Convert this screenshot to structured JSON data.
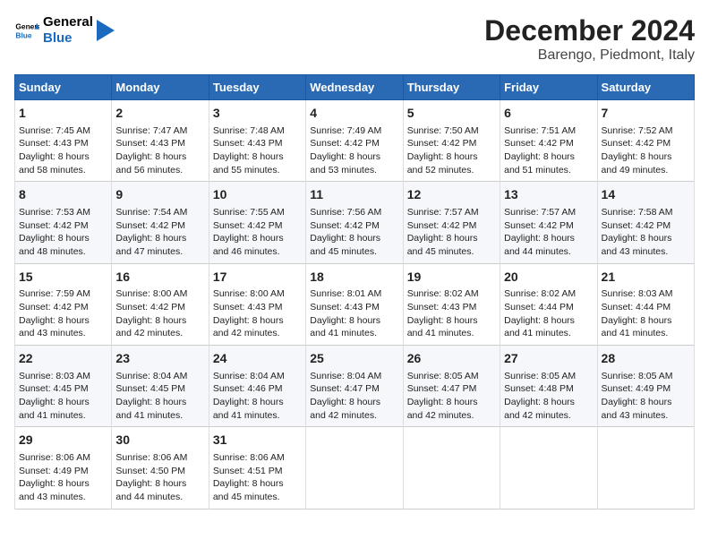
{
  "header": {
    "logo_general": "General",
    "logo_blue": "Blue",
    "title": "December 2024",
    "subtitle": "Barengo, Piedmont, Italy"
  },
  "days_of_week": [
    "Sunday",
    "Monday",
    "Tuesday",
    "Wednesday",
    "Thursday",
    "Friday",
    "Saturday"
  ],
  "weeks": [
    [
      {
        "day": "1",
        "sunrise": "7:45 AM",
        "sunset": "4:43 PM",
        "daylight": "8 hours and 58 minutes."
      },
      {
        "day": "2",
        "sunrise": "7:47 AM",
        "sunset": "4:43 PM",
        "daylight": "8 hours and 56 minutes."
      },
      {
        "day": "3",
        "sunrise": "7:48 AM",
        "sunset": "4:43 PM",
        "daylight": "8 hours and 55 minutes."
      },
      {
        "day": "4",
        "sunrise": "7:49 AM",
        "sunset": "4:42 PM",
        "daylight": "8 hours and 53 minutes."
      },
      {
        "day": "5",
        "sunrise": "7:50 AM",
        "sunset": "4:42 PM",
        "daylight": "8 hours and 52 minutes."
      },
      {
        "day": "6",
        "sunrise": "7:51 AM",
        "sunset": "4:42 PM",
        "daylight": "8 hours and 51 minutes."
      },
      {
        "day": "7",
        "sunrise": "7:52 AM",
        "sunset": "4:42 PM",
        "daylight": "8 hours and 49 minutes."
      }
    ],
    [
      {
        "day": "8",
        "sunrise": "7:53 AM",
        "sunset": "4:42 PM",
        "daylight": "8 hours and 48 minutes."
      },
      {
        "day": "9",
        "sunrise": "7:54 AM",
        "sunset": "4:42 PM",
        "daylight": "8 hours and 47 minutes."
      },
      {
        "day": "10",
        "sunrise": "7:55 AM",
        "sunset": "4:42 PM",
        "daylight": "8 hours and 46 minutes."
      },
      {
        "day": "11",
        "sunrise": "7:56 AM",
        "sunset": "4:42 PM",
        "daylight": "8 hours and 45 minutes."
      },
      {
        "day": "12",
        "sunrise": "7:57 AM",
        "sunset": "4:42 PM",
        "daylight": "8 hours and 45 minutes."
      },
      {
        "day": "13",
        "sunrise": "7:57 AM",
        "sunset": "4:42 PM",
        "daylight": "8 hours and 44 minutes."
      },
      {
        "day": "14",
        "sunrise": "7:58 AM",
        "sunset": "4:42 PM",
        "daylight": "8 hours and 43 minutes."
      }
    ],
    [
      {
        "day": "15",
        "sunrise": "7:59 AM",
        "sunset": "4:42 PM",
        "daylight": "8 hours and 43 minutes."
      },
      {
        "day": "16",
        "sunrise": "8:00 AM",
        "sunset": "4:42 PM",
        "daylight": "8 hours and 42 minutes."
      },
      {
        "day": "17",
        "sunrise": "8:00 AM",
        "sunset": "4:43 PM",
        "daylight": "8 hours and 42 minutes."
      },
      {
        "day": "18",
        "sunrise": "8:01 AM",
        "sunset": "4:43 PM",
        "daylight": "8 hours and 41 minutes."
      },
      {
        "day": "19",
        "sunrise": "8:02 AM",
        "sunset": "4:43 PM",
        "daylight": "8 hours and 41 minutes."
      },
      {
        "day": "20",
        "sunrise": "8:02 AM",
        "sunset": "4:44 PM",
        "daylight": "8 hours and 41 minutes."
      },
      {
        "day": "21",
        "sunrise": "8:03 AM",
        "sunset": "4:44 PM",
        "daylight": "8 hours and 41 minutes."
      }
    ],
    [
      {
        "day": "22",
        "sunrise": "8:03 AM",
        "sunset": "4:45 PM",
        "daylight": "8 hours and 41 minutes."
      },
      {
        "day": "23",
        "sunrise": "8:04 AM",
        "sunset": "4:45 PM",
        "daylight": "8 hours and 41 minutes."
      },
      {
        "day": "24",
        "sunrise": "8:04 AM",
        "sunset": "4:46 PM",
        "daylight": "8 hours and 41 minutes."
      },
      {
        "day": "25",
        "sunrise": "8:04 AM",
        "sunset": "4:47 PM",
        "daylight": "8 hours and 42 minutes."
      },
      {
        "day": "26",
        "sunrise": "8:05 AM",
        "sunset": "4:47 PM",
        "daylight": "8 hours and 42 minutes."
      },
      {
        "day": "27",
        "sunrise": "8:05 AM",
        "sunset": "4:48 PM",
        "daylight": "8 hours and 42 minutes."
      },
      {
        "day": "28",
        "sunrise": "8:05 AM",
        "sunset": "4:49 PM",
        "daylight": "8 hours and 43 minutes."
      }
    ],
    [
      {
        "day": "29",
        "sunrise": "8:06 AM",
        "sunset": "4:49 PM",
        "daylight": "8 hours and 43 minutes."
      },
      {
        "day": "30",
        "sunrise": "8:06 AM",
        "sunset": "4:50 PM",
        "daylight": "8 hours and 44 minutes."
      },
      {
        "day": "31",
        "sunrise": "8:06 AM",
        "sunset": "4:51 PM",
        "daylight": "8 hours and 45 minutes."
      },
      null,
      null,
      null,
      null
    ]
  ],
  "labels": {
    "sunrise": "Sunrise: ",
    "sunset": "Sunset: ",
    "daylight": "Daylight: "
  }
}
